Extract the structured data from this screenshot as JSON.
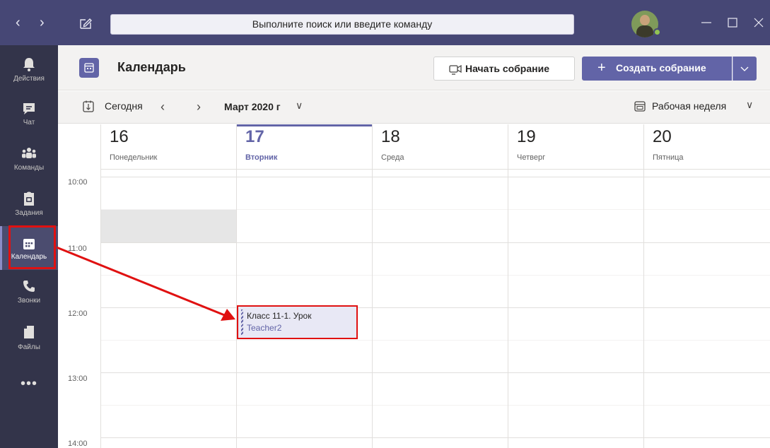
{
  "titlebar": {
    "back_label": "‹",
    "forward_label": "›",
    "search_placeholder": "Выполните поиск или введите команду",
    "minimize_label": "—",
    "close_label": "×"
  },
  "rail": {
    "items": [
      {
        "label": "Действия",
        "icon": "bell-icon"
      },
      {
        "label": "Чат",
        "icon": "chat-icon"
      },
      {
        "label": "Команды",
        "icon": "teams-icon"
      },
      {
        "label": "Задания",
        "icon": "assignments-icon"
      },
      {
        "label": "Календарь",
        "icon": "calendar-icon",
        "active": true
      },
      {
        "label": "Звонки",
        "icon": "phone-icon"
      },
      {
        "label": "Файлы",
        "icon": "file-icon"
      }
    ],
    "more_label": "•••"
  },
  "header": {
    "title": "Календарь",
    "meet_now_label": "Начать собрание",
    "new_meeting_label": "Создать собрание",
    "new_meeting_plus": "+"
  },
  "toolbar": {
    "today_label": "Сегодня",
    "prev_label": "‹",
    "next_label": "›",
    "month_label": "Март 2020 г",
    "view_label": "Рабочая неделя",
    "caret": "∨"
  },
  "days": [
    {
      "num": "16",
      "name": "Понедельник"
    },
    {
      "num": "17",
      "name": "Вторник",
      "today": true
    },
    {
      "num": "18",
      "name": "Среда"
    },
    {
      "num": "19",
      "name": "Четверг"
    },
    {
      "num": "20",
      "name": "Пятница"
    }
  ],
  "times": [
    "10:00",
    "11:00",
    "12:00",
    "13:00",
    "14:00"
  ],
  "event": {
    "title": "Класс 11-1. Урок",
    "organizer": "Teacher2"
  },
  "colors": {
    "accent": "#6264a7",
    "titlebar": "#464775",
    "rail": "#33344a",
    "highlight": "#e01111"
  }
}
